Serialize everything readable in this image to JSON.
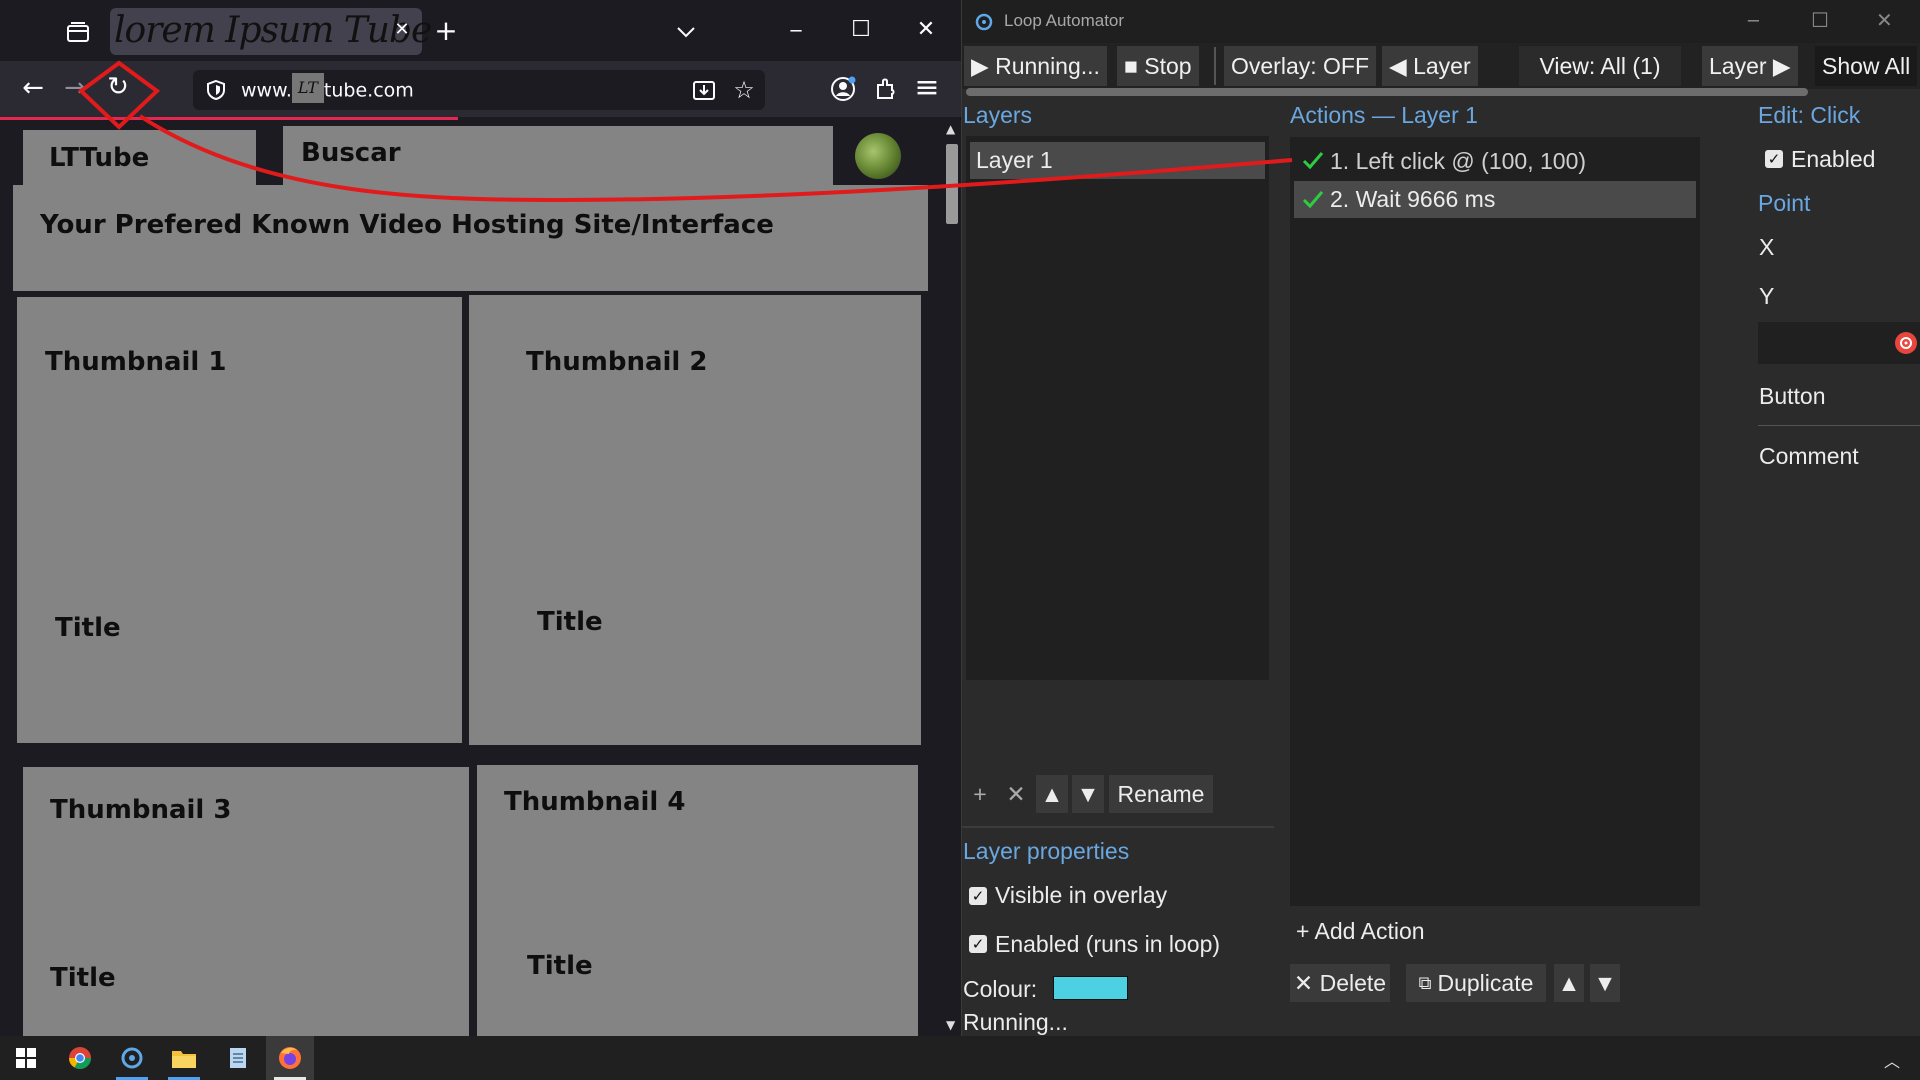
{
  "browser": {
    "tab_title": "lorem Ipsum Tube",
    "url_prefix": "www.",
    "url_host_mark": "LT",
    "url_suffix": "tube.com",
    "icons": {
      "tab_overview": "tab-overview-icon",
      "new_tab": "+",
      "tab_list": "⌄",
      "minimize": "─",
      "maximize": "☐",
      "close": "✕",
      "tab_close": "✕",
      "back": "←",
      "forward": "→",
      "reload": "↻",
      "hamburger": "≡"
    }
  },
  "page": {
    "logo": "LTTube",
    "search": "Buscar",
    "tagline": "Your Prefered Known Video Hosting Site/Interface",
    "videos": [
      {
        "thumb": "Thumbnail 1",
        "title": "Title"
      },
      {
        "thumb": "Thumbnail 2",
        "title": "Title"
      },
      {
        "thumb": "Thumbnail 3",
        "title": "Title"
      },
      {
        "thumb": "Thumbnail 4",
        "title": "Title"
      }
    ]
  },
  "app": {
    "title": "Loop Automator",
    "toolbar": {
      "running": "▶ Running...",
      "stop": "■ Stop",
      "overlay": "Overlay: OFF",
      "prev_layer": "◀ Layer",
      "view": "View: All (1)",
      "next_layer": "Layer ▶",
      "show_all": "Show All"
    },
    "layers": {
      "header": "Layers",
      "items": [
        "Layer 1"
      ],
      "add": "+",
      "remove": "✕",
      "up": "▲",
      "down": "▼",
      "rename": "Rename"
    },
    "layer_props": {
      "header": "Layer properties",
      "visible": "Visible in overlay",
      "enabled": "Enabled (runs in loop)",
      "colour_label": "Colour:",
      "colour": "#4dd0e1",
      "status": "Running..."
    },
    "actions": {
      "header": "Actions — Layer 1",
      "items": [
        "1. Left click @ (100, 100)",
        "2. Wait 9666 ms"
      ],
      "add": "+ Add Action",
      "delete": "✕ Delete",
      "duplicate": "Duplicate",
      "up": "▲",
      "down": "▼"
    },
    "edit": {
      "header": "Edit: Click",
      "enabled": "Enabled",
      "point": "Point",
      "x": "X",
      "y": "Y",
      "button": "Button",
      "comment": "Comment"
    }
  },
  "colors": {
    "accent_blue": "#6aa7e0",
    "check_green": "#2ecc40",
    "overlay_red": "#e11b1b",
    "page_grey": "#848484"
  }
}
